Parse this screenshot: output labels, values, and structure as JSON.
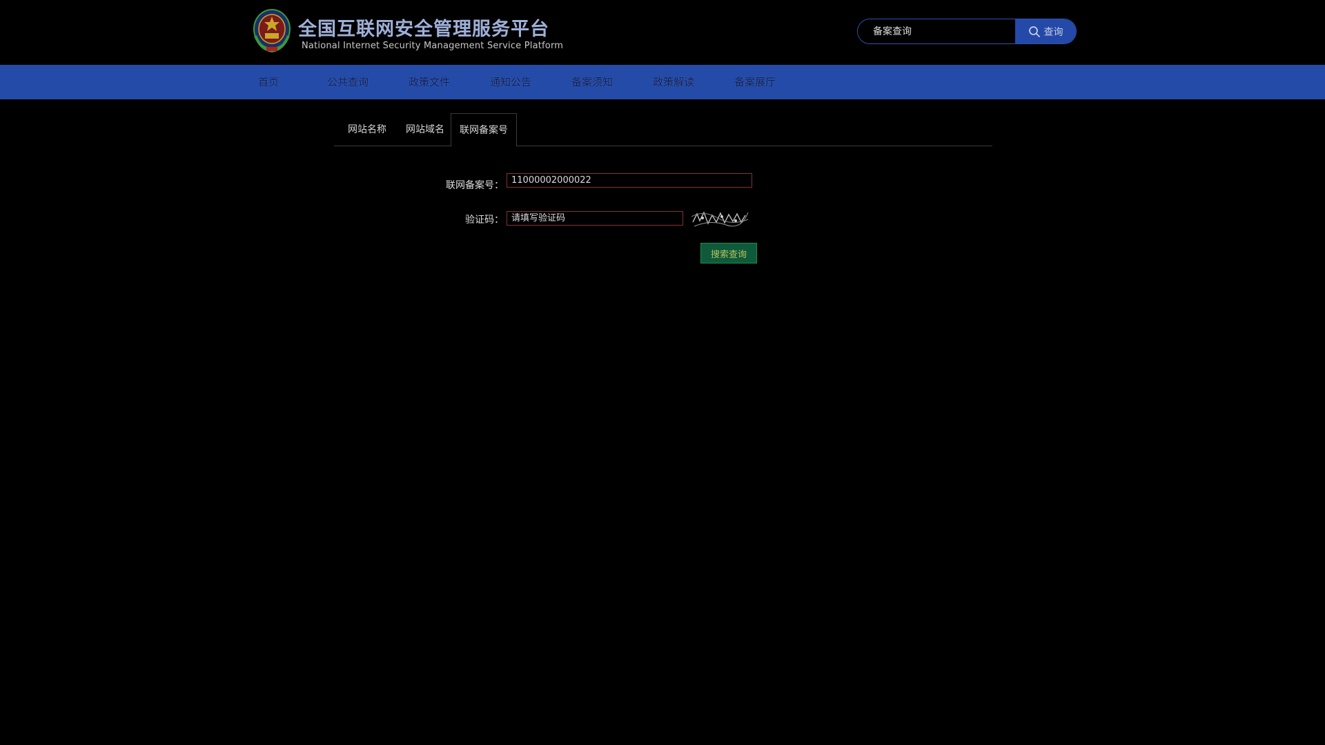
{
  "header": {
    "title": "全国互联网安全管理服务平台",
    "subtitle": "National Internet Security Management Service Platform",
    "logo_icon": "police-emblem-icon",
    "search": {
      "placeholder": "备案查询",
      "button_label": "查询",
      "button_icon": "search-icon"
    }
  },
  "nav": {
    "items": [
      {
        "label": "首页"
      },
      {
        "label": "公共查询"
      },
      {
        "label": "政策文件"
      },
      {
        "label": "通知公告"
      },
      {
        "label": "备案须知"
      },
      {
        "label": "政策解读"
      },
      {
        "label": "备案展厅"
      }
    ]
  },
  "tabs": {
    "items": [
      {
        "label": "网站名称"
      },
      {
        "label": "网站域名"
      },
      {
        "label": "联网备案号"
      }
    ],
    "active": "联网备案号"
  },
  "form": {
    "record_label": "联网备案号：",
    "record_value": "11000002000022",
    "captcha_label": "验证码：",
    "captcha_placeholder": "请填写验证码",
    "submit_label": "搜索查询"
  },
  "colors": {
    "nav_background": "#244ba8",
    "search_button": "#2449a8",
    "submit_button": "#0e5a3a",
    "input_border": "#8a3030"
  }
}
